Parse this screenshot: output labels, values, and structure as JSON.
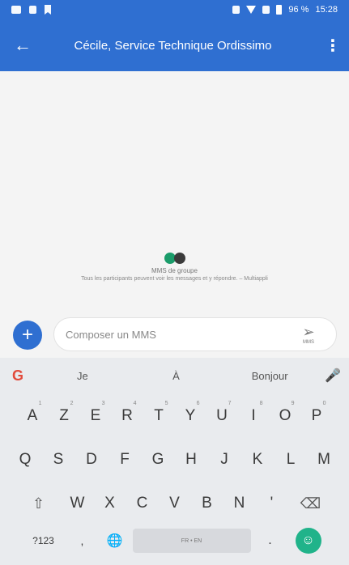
{
  "status_bar": {
    "left_icons": [
      "minus-icon",
      "image-icon",
      "bookmark-icon"
    ],
    "right_icons": [
      "vibrate-icon",
      "wifi-icon",
      "signal-icon",
      "battery-icon"
    ],
    "battery_text": "96 %",
    "time": "15:28"
  },
  "app_bar": {
    "back_icon": "arrow-left-icon",
    "back_glyph": "←",
    "title": "Cécile, Service Technique Ordissimo",
    "menu_glyph": "⋮"
  },
  "group": {
    "label": "MMS de groupe",
    "description": "Tous les participants peuvent voir les messages et y répondre. – Multiappli"
  },
  "compose": {
    "plus_glyph": "+",
    "placeholder": "Composer un MMS",
    "send_arrow": "➢",
    "send_label": "MMS"
  },
  "keyboard": {
    "google_glyph": "G",
    "suggestions": [
      "Je",
      "À",
      "Bonjour"
    ],
    "mic_glyph": "🎤",
    "row1": [
      {
        "key": "A",
        "sup": "1"
      },
      {
        "key": "Z",
        "sup": "2"
      },
      {
        "key": "E",
        "sup": "3"
      },
      {
        "key": "R",
        "sup": "4"
      },
      {
        "key": "T",
        "sup": "5"
      },
      {
        "key": "Y",
        "sup": "6"
      },
      {
        "key": "U",
        "sup": "7"
      },
      {
        "key": "I",
        "sup": "8"
      },
      {
        "key": "O",
        "sup": "9"
      },
      {
        "key": "P",
        "sup": "0"
      }
    ],
    "row2": [
      "Q",
      "S",
      "D",
      "F",
      "G",
      "H",
      "J",
      "K",
      "L",
      "M"
    ],
    "row3": [
      "W",
      "X",
      "C",
      "V",
      "B",
      "N",
      "'"
    ],
    "shift_glyph": "⇧",
    "delete_glyph": "⌫",
    "num_label": "?123",
    "comma_glyph": ",",
    "globe_glyph": "🌐",
    "space_label": "FR • EN",
    "period_glyph": ".",
    "enter_glyph": "☺"
  },
  "colors": {
    "primary": "#2f6fd1",
    "enter_button": "#20b38a"
  }
}
